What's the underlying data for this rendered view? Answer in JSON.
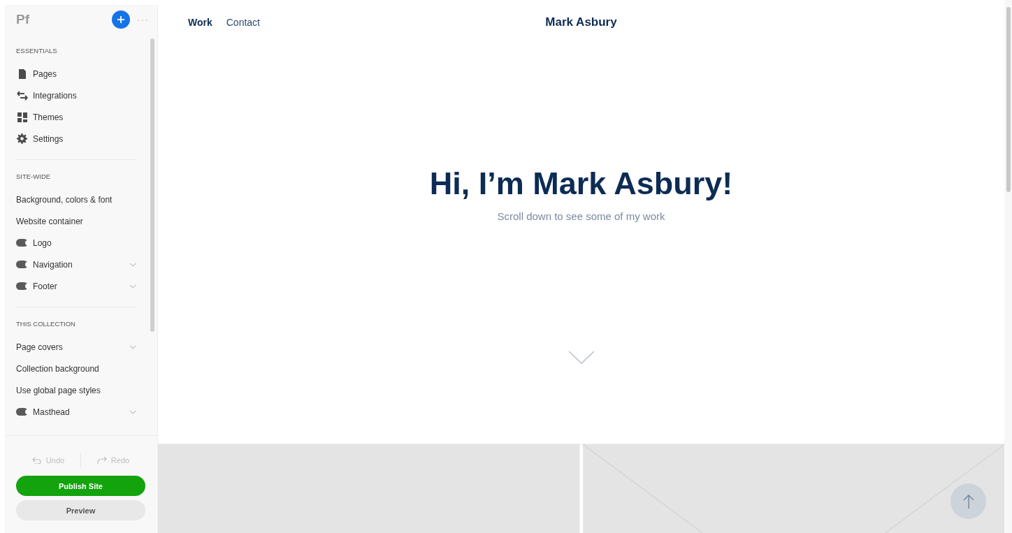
{
  "sidebar": {
    "logo": "Pf",
    "more": "···",
    "sections": [
      {
        "title": "ESSENTIALS",
        "items": [
          {
            "kind": "icon-link",
            "label": "Pages"
          },
          {
            "kind": "icon-link",
            "label": "Integrations"
          },
          {
            "kind": "icon-link",
            "label": "Themes"
          },
          {
            "kind": "icon-link",
            "label": "Settings"
          }
        ]
      },
      {
        "title": "SITE-WIDE",
        "items": [
          {
            "kind": "link",
            "label": "Background, colors & font",
            "expandable": false
          },
          {
            "kind": "link",
            "label": "Website container",
            "expandable": false
          },
          {
            "kind": "toggle",
            "label": "Logo",
            "on": true,
            "expandable": false
          },
          {
            "kind": "toggle",
            "label": "Navigation",
            "on": true,
            "expandable": true
          },
          {
            "kind": "toggle",
            "label": "Footer",
            "on": true,
            "expandable": true
          }
        ]
      },
      {
        "title": "THIS COLLECTION",
        "items": [
          {
            "kind": "link",
            "label": "Page covers",
            "expandable": true
          },
          {
            "kind": "link",
            "label": "Collection background",
            "expandable": false
          },
          {
            "kind": "link",
            "label": "Use global page styles",
            "expandable": false
          },
          {
            "kind": "toggle",
            "label": "Masthead",
            "on": true,
            "expandable": true
          }
        ]
      }
    ],
    "undo": {
      "label": "Undo",
      "disabled": true
    },
    "redo": {
      "label": "Redo",
      "disabled": true
    },
    "publish": "Publish Site",
    "preview": "Preview"
  },
  "site": {
    "nav": [
      {
        "label": "Work",
        "selected": true
      },
      {
        "label": "Contact",
        "selected": false
      }
    ],
    "site_title": "Mark Asbury",
    "hero_title": "Hi, I’m Mark Asbury!",
    "hero_subtitle": "Scroll down to see some of my work"
  }
}
